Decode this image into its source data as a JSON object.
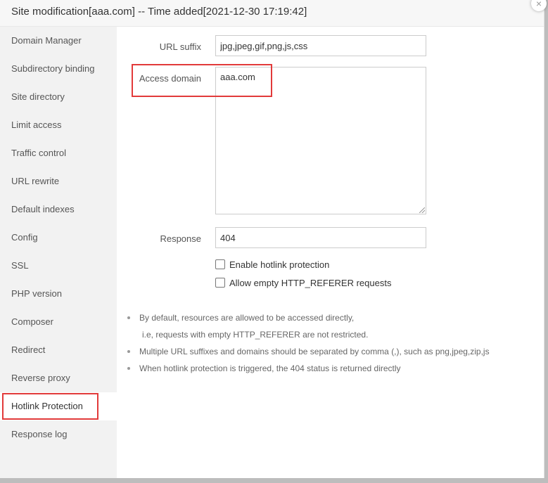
{
  "dialog": {
    "title": "Site modification[aaa.com] -- Time added[2021-12-30 17:19:42]",
    "close_glyph": "×"
  },
  "sidebar": {
    "items": [
      {
        "label": "Domain Manager"
      },
      {
        "label": "Subdirectory binding"
      },
      {
        "label": "Site directory"
      },
      {
        "label": "Limit access"
      },
      {
        "label": "Traffic control"
      },
      {
        "label": "URL rewrite"
      },
      {
        "label": "Default indexes"
      },
      {
        "label": "Config"
      },
      {
        "label": "SSL"
      },
      {
        "label": "PHP version"
      },
      {
        "label": "Composer"
      },
      {
        "label": "Redirect"
      },
      {
        "label": "Reverse proxy"
      },
      {
        "label": "Hotlink Protection"
      },
      {
        "label": "Response log"
      }
    ],
    "active": "Hotlink Protection"
  },
  "form": {
    "url_suffix_label": "URL suffix",
    "url_suffix_value": "jpg,jpeg,gif,png,js,css",
    "access_domain_label": "Access domain",
    "access_domain_value": "aaa.com",
    "response_label": "Response",
    "response_value": "404",
    "enable_hotlink_label": "Enable hotlink protection",
    "enable_hotlink_checked": false,
    "allow_empty_referer_label": "Allow empty HTTP_REFERER requests",
    "allow_empty_referer_checked": false
  },
  "tips": {
    "line1": "By default, resources are allowed to be accessed directly,",
    "line1b": "i.e, requests with empty HTTP_REFERER are not restricted.",
    "line2": "Multiple URL suffixes and domains should be separated by comma (,), such as png,jpeg,zip,js",
    "line3": "When hotlink protection is triggered, the 404 status is returned directly"
  },
  "colors": {
    "highlight": "#e23a3a",
    "sidebar_bg": "#f2f2f2"
  }
}
